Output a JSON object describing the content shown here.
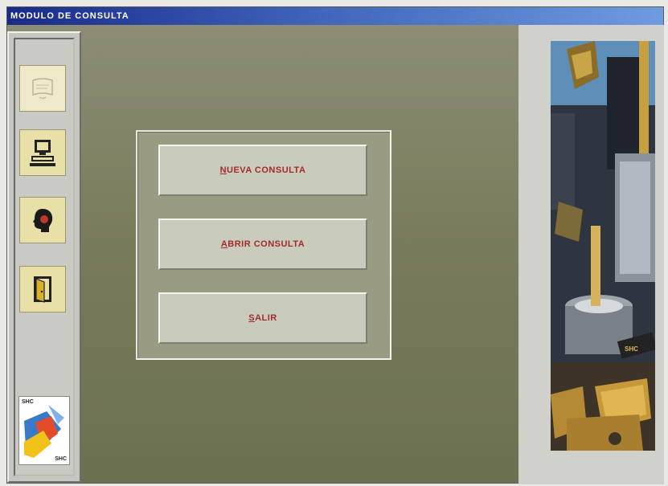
{
  "window": {
    "title": "MODULO DE CONSULTA"
  },
  "toolbar": {
    "buttons": [
      {
        "name": "scroll-icon",
        "enabled": false
      },
      {
        "name": "computer-icon",
        "enabled": true
      },
      {
        "name": "head-profile-icon",
        "enabled": true
      },
      {
        "name": "door-exit-icon",
        "enabled": true
      }
    ]
  },
  "logo": {
    "text_top": "SHC",
    "text_bottom": "SHC"
  },
  "menu": {
    "nueva_consulta": {
      "accel": "N",
      "rest": "UEVA CONSULTA"
    },
    "abrir_consulta": {
      "accel": "A",
      "rest": "BRIR CONSULTA"
    },
    "salir": {
      "accel": "S",
      "rest": "ALIR"
    }
  },
  "colors": {
    "title_bar_start": "#1a2a8a",
    "title_bar_end": "#6f9be0",
    "button_text": "#a32a2a",
    "icon_button_bg": "#e9dfa8",
    "background": "#7d8063"
  }
}
